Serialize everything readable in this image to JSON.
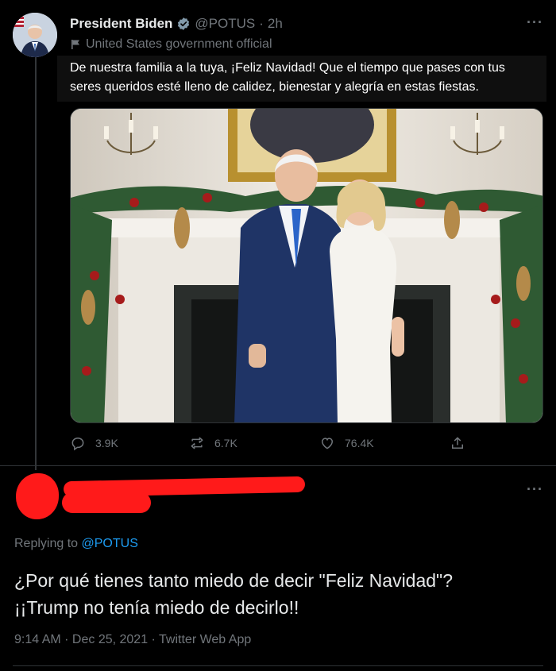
{
  "tweet": {
    "author_name": "President Biden",
    "handle": "@POTUS",
    "separator": "·",
    "time": "2h",
    "label": "United States government official",
    "text": "De nuestra familia a la tuya, ¡Feliz Navidad! Que el tiempo que pases con tus seres queridos esté lleno de calidez, bienestar y alegría en estas fiestas.",
    "more": "···",
    "stats": {
      "replies": "3.9K",
      "retweets": "6.7K",
      "likes": "76.4K"
    }
  },
  "reply": {
    "replying_prefix": "Replying to",
    "replying_to": "@POTUS",
    "text_line1": "¿Por qué tienes tanto miedo de decir \"Feliz Navidad\"?",
    "text_line2": "¡¡Trump no tenía miedo de decirlo!!",
    "meta": "9:14 AM · Dec 25, 2021 · Twitter Web App",
    "more": "···"
  },
  "colors": {
    "background": "#000000",
    "text_primary": "#e7e9ea",
    "text_secondary": "#71767b",
    "link": "#1d9bf0",
    "redaction": "#ff1a1a"
  },
  "icons": [
    "verified-badge-icon",
    "flag-icon",
    "reply-icon",
    "retweet-icon",
    "like-icon",
    "share-icon",
    "more-icon"
  ]
}
